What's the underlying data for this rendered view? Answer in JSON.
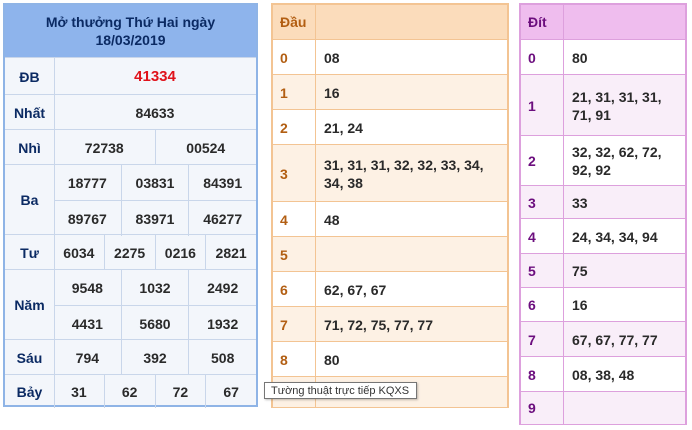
{
  "result": {
    "title_line1": "Mở thưởng Thứ Hai ngày",
    "title_line2": "18/03/2019",
    "db_label": "ĐB",
    "db": "41334",
    "nhat_label": "Nhất",
    "nhat": "84633",
    "nhi_label": "Nhì",
    "nhi": [
      "72738",
      "00524"
    ],
    "ba_label": "Ba",
    "ba": [
      "18777",
      "03831",
      "84391",
      "89767",
      "83971",
      "46277"
    ],
    "tu_label": "Tư",
    "tu": [
      "6034",
      "2275",
      "0216",
      "2821"
    ],
    "nam_label": "Năm",
    "nam": [
      "9548",
      "1032",
      "2492",
      "4431",
      "5680",
      "1932"
    ],
    "sau_label": "Sáu",
    "sau": [
      "794",
      "392",
      "508"
    ],
    "bay_label": "Bảy",
    "bay": [
      "31",
      "62",
      "72",
      "67"
    ]
  },
  "dau": {
    "header": "Đầu",
    "rows": [
      {
        "key": "0",
        "value": "08"
      },
      {
        "key": "1",
        "value": "16"
      },
      {
        "key": "2",
        "value": "21, 24"
      },
      {
        "key": "3",
        "value": "31, 31, 31, 32, 32, 33, 34, 34, 38"
      },
      {
        "key": "4",
        "value": "48"
      },
      {
        "key": "5",
        "value": ""
      },
      {
        "key": "6",
        "value": "62, 67, 67"
      },
      {
        "key": "7",
        "value": "71, 72, 75, 77, 77"
      },
      {
        "key": "8",
        "value": "80"
      }
    ]
  },
  "dit": {
    "header": "Đít",
    "rows": [
      {
        "key": "0",
        "value": "80"
      },
      {
        "key": "1",
        "value": "21, 31, 31, 31, 71, 91"
      },
      {
        "key": "2",
        "value": "32, 32, 62, 72, 92, 92"
      },
      {
        "key": "3",
        "value": "33"
      },
      {
        "key": "4",
        "value": "24, 34, 34, 94"
      },
      {
        "key": "5",
        "value": "75"
      },
      {
        "key": "6",
        "value": "16"
      },
      {
        "key": "7",
        "value": "67, 67, 77, 77"
      },
      {
        "key": "8",
        "value": "08, 38, 48"
      },
      {
        "key": "9",
        "value": ""
      }
    ]
  },
  "tooltip": "Tường thuật trực tiếp KQXS"
}
